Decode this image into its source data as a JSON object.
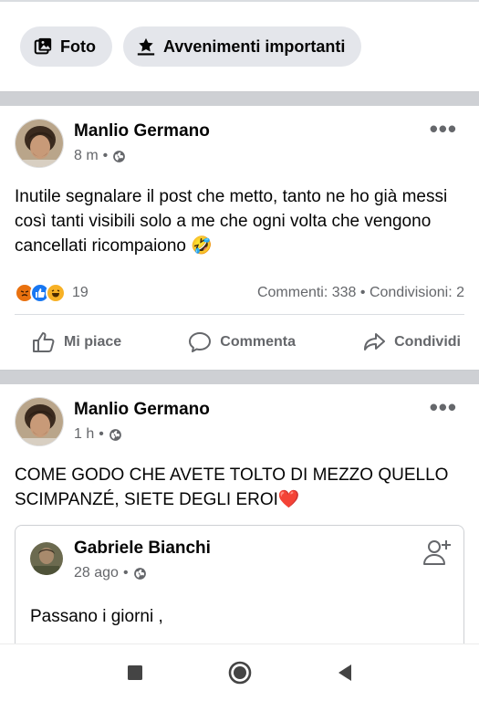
{
  "composer": {
    "photo_label": "Foto",
    "events_label": "Avvenimenti importanti"
  },
  "post1": {
    "author": "Manlio Germano",
    "time": "8 m",
    "text": "Inutile segnalare il post che metto, tanto ne ho già messi così tanti visibili solo a me che ogni volta che vengono cancellati ricompaiono 🤣",
    "reaction_count": "19",
    "counts": "Commenti: 338 • Condivisioni: 2",
    "reactions": [
      "angry",
      "like",
      "haha"
    ],
    "actions": {
      "like": "Mi piace",
      "comment": "Commenta",
      "share": "Condividi"
    }
  },
  "post2": {
    "author": "Manlio Germano",
    "time": "1 h",
    "text": "COME GODO CHE AVETE TOLTO DI MEZZO QUELLO SCIMPANZÉ, SIETE DEGLI EROI❤️",
    "shared": {
      "author": "Gabriele Bianchi",
      "time": "28 ago",
      "text": "Passano i giorni ,"
    }
  },
  "colors": {
    "secondary_text": "#65676b",
    "separator": "#ced0d4",
    "chip_bg": "#e4e6eb",
    "like_blue": "#1877f2",
    "angry_orange": "#e9710f",
    "haha_yellow": "#f7b125"
  },
  "icons": {
    "photo": "photo-icon",
    "events": "star-flag-icon",
    "globe": "globe-icon",
    "more": "more-dots-icon",
    "like": "thumbs-up-icon",
    "comment": "comment-bubble-icon",
    "share": "share-arrow-icon",
    "add_friend": "add-friend-icon",
    "nav_recents": "square-icon",
    "nav_home": "circle-icon",
    "nav_back": "triangle-back-icon"
  }
}
